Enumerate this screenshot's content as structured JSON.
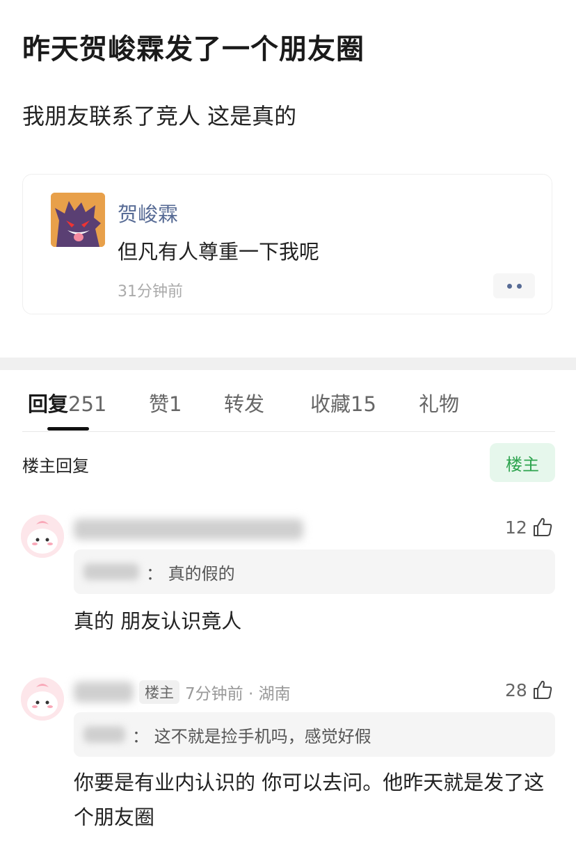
{
  "post": {
    "title": "昨天贺峻霖发了一个朋友圈",
    "body": "我朋友联系了竞人  这是真的"
  },
  "moment": {
    "name": "贺峻霖",
    "text": "但凡有人尊重一下我呢",
    "time": "31分钟前"
  },
  "tabs": [
    {
      "label": "回复",
      "count": "251"
    },
    {
      "label": "赞",
      "count": "1"
    },
    {
      "label": "转发",
      "count": ""
    },
    {
      "label": "收藏",
      "count": "15"
    },
    {
      "label": "礼物",
      "count": ""
    }
  ],
  "filter": {
    "label": "楼主回复",
    "button": "楼主"
  },
  "comments": [
    {
      "likes": "12",
      "quote": "： 真的假的",
      "text": "真的 朋友认识竟人"
    },
    {
      "badge": "楼主",
      "meta": "7分钟前 · 湖南",
      "likes": "28",
      "quote": "： 这不就是捡手机吗，感觉好假",
      "text": "你要是有业内认识的 你可以去问。他昨天就是发了这个朋友圈"
    }
  ],
  "colors": {
    "link_blue": "#576b95",
    "accent_green": "#2ea44f"
  }
}
